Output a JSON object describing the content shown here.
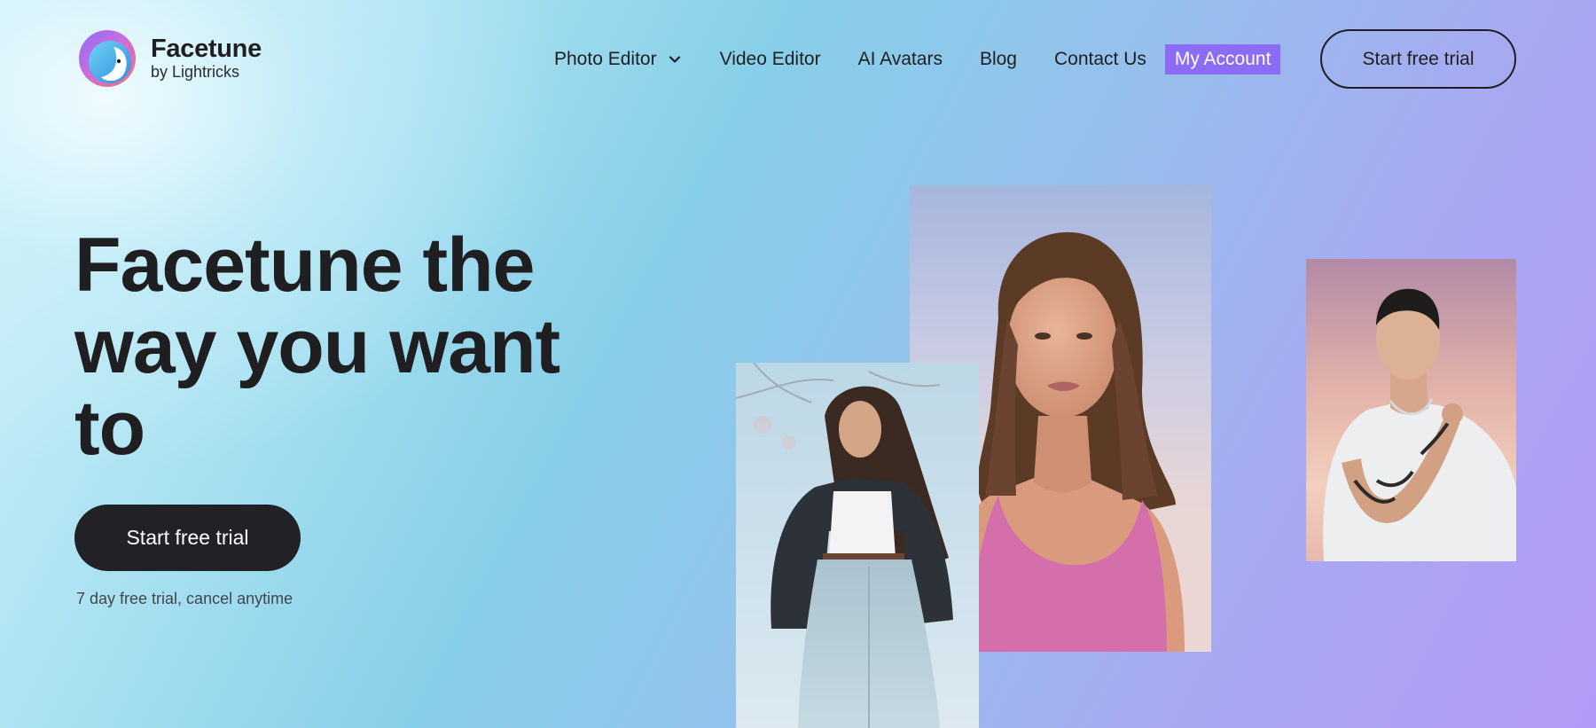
{
  "brand": {
    "name": "Facetune",
    "sub": "by Lightricks",
    "logo_icon": "facetune-face-logo"
  },
  "nav": {
    "photo_editor": "Photo Editor",
    "photo_editor_icon": "chevron-down-icon",
    "video_editor": "Video Editor",
    "ai_avatars": "AI Avatars",
    "blog": "Blog",
    "contact": "Contact Us",
    "account": "My Account",
    "cta": "Start free trial"
  },
  "hero": {
    "headline_line1": "Facetune the",
    "headline_line2": "way you want",
    "headline_line3": "to",
    "cta": "Start free trial",
    "note": "7 day free trial, cancel anytime"
  },
  "images": [
    {
      "id": "portrait-woman-pink-top"
    },
    {
      "id": "portrait-woman-leather-jacket"
    },
    {
      "id": "portrait-man-white-tshirt"
    }
  ],
  "colors": {
    "account_bg": "#8c6cf4",
    "cta_dark": "#222226",
    "text_dark": "#1f1f22"
  }
}
